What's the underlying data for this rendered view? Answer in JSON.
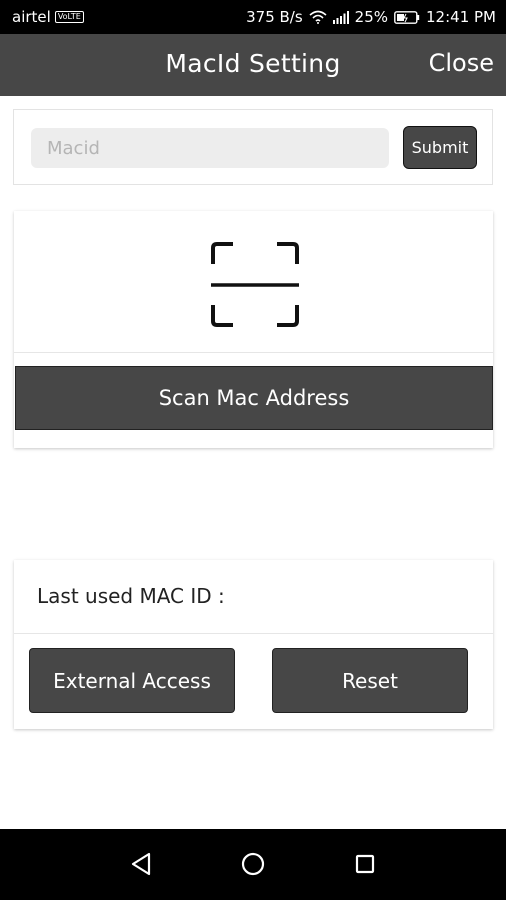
{
  "status_bar": {
    "carrier": "airtel",
    "volte": "VoLTE",
    "speed": "375 B/s",
    "battery": "25%",
    "time": "12:41 PM"
  },
  "app_bar": {
    "title": "MacId Setting",
    "close_label": "Close"
  },
  "mac_form": {
    "placeholder": "Macid",
    "value": "",
    "submit_label": "Submit"
  },
  "scan": {
    "icon": "qr-scan-icon",
    "button_label": "Scan Mac Address"
  },
  "last_used": {
    "label": "Last used MAC ID :",
    "external_access_label": "External Access",
    "reset_label": "Reset"
  },
  "nav_bar": {
    "back_icon": "back-triangle-icon",
    "home_icon": "home-circle-icon",
    "recent_icon": "recent-square-icon"
  },
  "colors": {
    "app_bar": "#474747",
    "button": "#474747",
    "input_bg": "#ededed"
  }
}
